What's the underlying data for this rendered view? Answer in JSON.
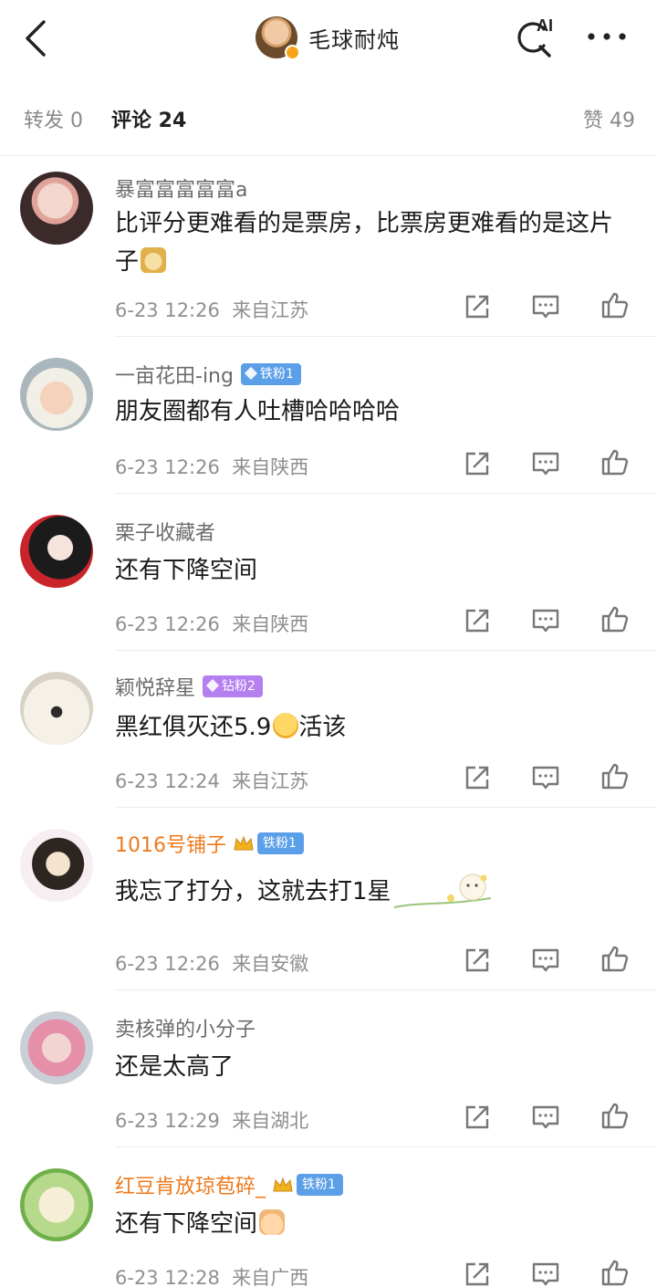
{
  "header": {
    "title": "毛球耐炖",
    "ai_label": "AI",
    "icons": [
      "back-icon",
      "ai-search-icon",
      "more-icon"
    ]
  },
  "tabs": {
    "repost": "转发 0",
    "comment": "评论 24",
    "like": "赞 49"
  },
  "colors": {
    "accent_orange": "#ee7a1d",
    "iron_badge": "#5b9fe9",
    "diamond_badge": "#b57ff0",
    "meta_gray": "#8f8f8f"
  },
  "comments": [
    {
      "username": "暴富富富富富a",
      "badge": "",
      "text": "比评分更难看的是票房，比票房更难看的是这片子",
      "emoji": "doge",
      "time": "6-23 12:26",
      "location": "来自江苏"
    },
    {
      "username": "一亩花田-ing",
      "badge": "铁粉1",
      "text": "朋友圈都有人吐槽哈哈哈哈",
      "emoji": "",
      "time": "6-23 12:26",
      "location": "来自陕西"
    },
    {
      "username": "栗子收藏者",
      "badge": "",
      "text": "还有下降空间",
      "emoji": "",
      "time": "6-23 12:26",
      "location": "来自陕西"
    },
    {
      "username": "颖悦辞星",
      "badge": "钻粉2",
      "text": "黑红俱灭还5.9",
      "text_after": "活该",
      "emoji": "smile",
      "time": "6-23 12:24",
      "location": "来自江苏"
    },
    {
      "username": "1016号铺子",
      "badge": "铁粉1",
      "text": "我忘了打分，这就去打1星",
      "emoji": "",
      "time": "6-23 12:26",
      "location": "来自安徽"
    },
    {
      "username": "卖核弹的小分子",
      "badge": "",
      "text": "还是太高了",
      "emoji": "",
      "time": "6-23 12:29",
      "location": "来自湖北"
    },
    {
      "username": "红豆肯放琼苞碎_",
      "badge": "铁粉1",
      "text": "还有下降空间",
      "emoji": "victory",
      "time": "6-23 12:28",
      "location": "来自广西"
    }
  ]
}
